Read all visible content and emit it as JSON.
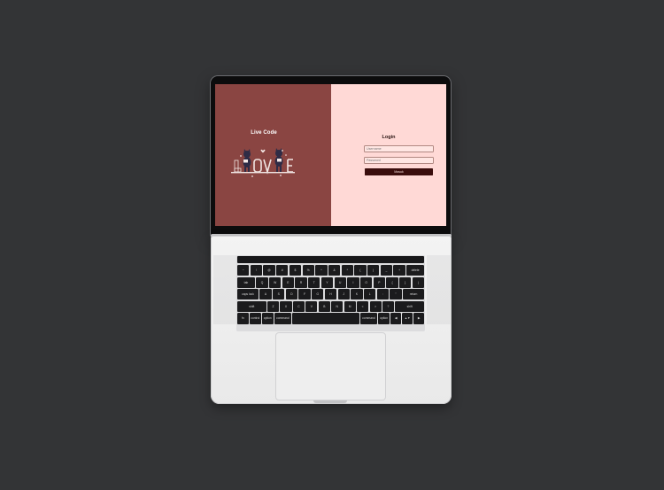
{
  "app": {
    "brand": "Live Code"
  },
  "login": {
    "title": "Login",
    "username_placeholder": "Username",
    "password_placeholder": "Password",
    "submit_label": "Masuk"
  },
  "colors": {
    "background": "#333436",
    "left_panel": "#8a4542",
    "right_panel": "#ffd9d6",
    "button": "#3a0d0c"
  },
  "keyboard": {
    "rows": [
      [
        "~",
        "!",
        "@",
        "#",
        "$",
        "%",
        "^",
        "&",
        "*",
        "(",
        ")",
        "_",
        "+",
        "delete"
      ],
      [
        "tab",
        "Q",
        "W",
        "E",
        "R",
        "T",
        "Y",
        "U",
        "I",
        "O",
        "P",
        "{",
        "}",
        "|"
      ],
      [
        "caps lock",
        "A",
        "S",
        "D",
        "F",
        "G",
        "H",
        "J",
        "K",
        "L",
        ":",
        "\"",
        "return"
      ],
      [
        "shift",
        "Z",
        "X",
        "C",
        "V",
        "B",
        "N",
        "M",
        "<",
        ">",
        "?",
        "shift"
      ],
      [
        "fn",
        "control",
        "option",
        "command",
        "",
        "command",
        "option"
      ]
    ],
    "arrows": [
      "◀",
      "▲▼",
      "▶"
    ]
  },
  "icons": {
    "illustration": "two-cats-with-love-letters-illustration"
  }
}
